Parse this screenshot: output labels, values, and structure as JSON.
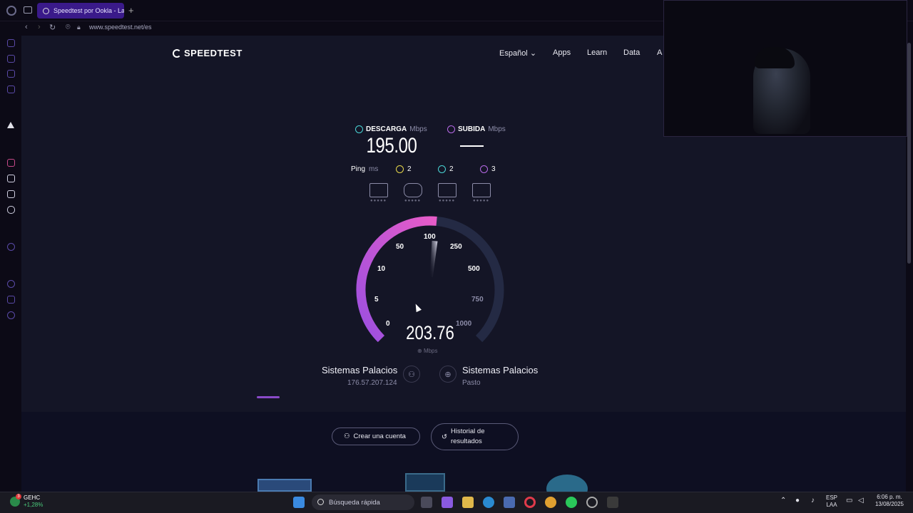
{
  "browser": {
    "tab_title": "Speedtest por Ookla - La",
    "url": "www.speedtest.net/es"
  },
  "site": {
    "brand": "SPEEDTEST",
    "nav": [
      "Español",
      "Apps",
      "Learn",
      "Data",
      "A"
    ]
  },
  "results": {
    "download_label": "DESCARGA",
    "download_unit": "Mbps",
    "download_value": "195.00",
    "upload_label": "SUBIDA",
    "upload_unit": "Mbps",
    "ping_label": "Ping",
    "ping_unit": "ms",
    "ping_idle": "2",
    "ping_download": "2",
    "ping_upload": "3"
  },
  "gauge": {
    "current_value": "203.76",
    "unit": "Mbps",
    "scale_labels": [
      "0",
      "5",
      "10",
      "50",
      "100",
      "250",
      "500",
      "750",
      "1000"
    ],
    "fill_fraction": 0.52,
    "colors": {
      "fill_start": "#9b4fe0",
      "fill_end": "#e85cc8",
      "track": "#242a44"
    }
  },
  "provider": {
    "isp_name": "Sistemas Palacios",
    "ip": "176.57.207.124",
    "server_name": "Sistemas Palacios",
    "server_location": "Pasto"
  },
  "actions": {
    "create_account": "Crear una cuenta",
    "history_line1": "Historial de",
    "history_line2": "resultados"
  },
  "taskbar": {
    "stock_name": "GEHC",
    "stock_change": "+1,28%",
    "notification_badge": "3",
    "search_placeholder": "Búsqueda rápida",
    "lang_line1": "ESP",
    "lang_line2": "LAA",
    "time": "6:06 p. m.",
    "date": "13/08/2025"
  },
  "accent_colors": {
    "download": "#4ad6d6",
    "upload": "#b86ae8",
    "ping": "#e8d84a",
    "tab_active": "#3a1a8a"
  }
}
